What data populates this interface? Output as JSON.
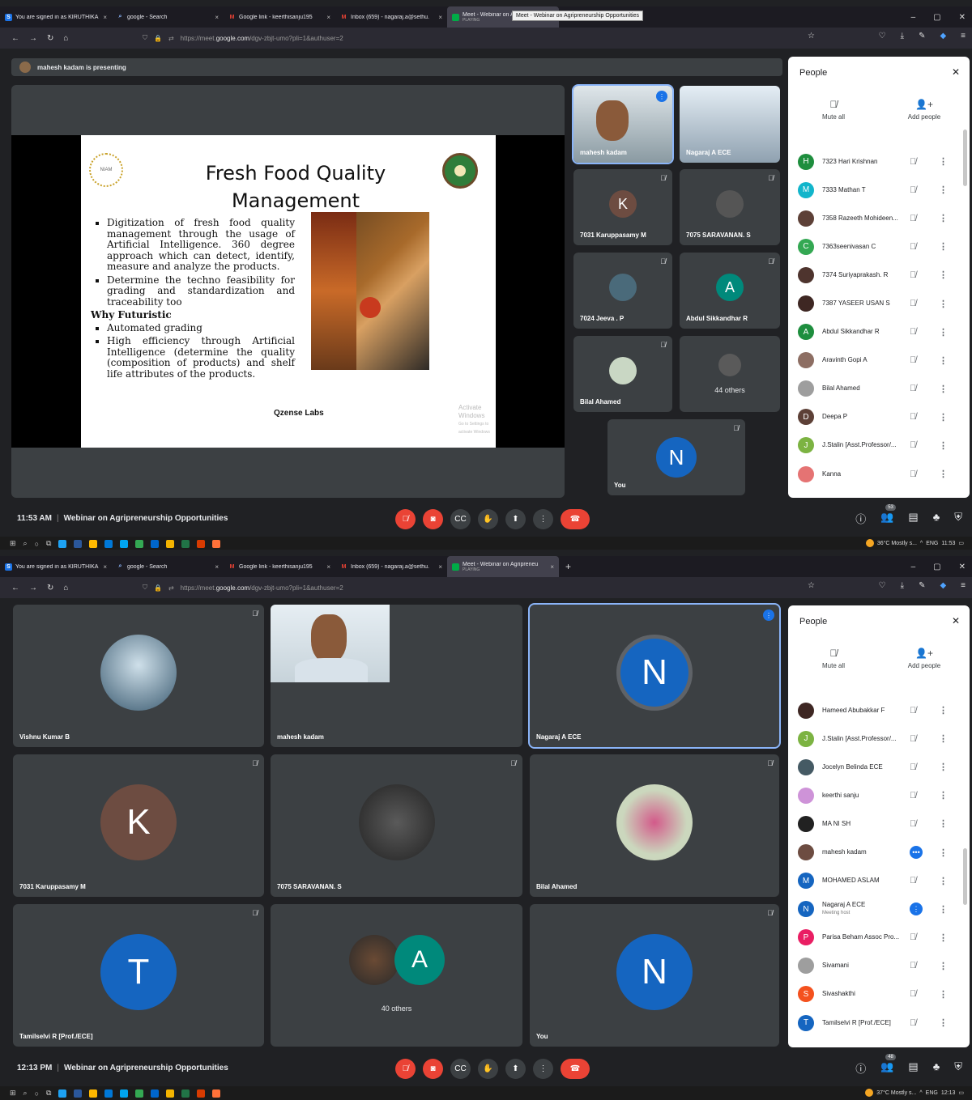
{
  "screenshots": [
    {
      "tabs": [
        {
          "label": "You are signed in as KIRUTHIKA",
          "icon": "s-icon",
          "color": "#1a73e8"
        },
        {
          "label": "google - Search",
          "icon": "search-icon",
          "color": "#5f6368"
        },
        {
          "label": "Google link - keerthisanju195",
          "icon": "gmail-icon",
          "color": "#ea4335"
        },
        {
          "label": "Inbox (659) - nagaraj.a@sethu.",
          "icon": "gmail-icon",
          "color": "#ea4335"
        },
        {
          "label": "Meet - Webinar on Agripreneu",
          "sub": "PLAYING",
          "icon": "meet-icon",
          "color": "#00ac47",
          "active": true
        }
      ],
      "tooltip": "Meet - Webinar on Agripreneurship Opportunities",
      "url_prefix": "https://meet.",
      "url_host": "google.com",
      "url_path": "/dgv-zbjt-umo?pli=1&authuser=2",
      "presenting": "mahesh kadam is presenting",
      "slide": {
        "title": "Fresh Food Quality Management",
        "logo_left": "NIAM",
        "bullets1": [
          "Digitization of fresh food quality management through the usage of Artificial Intelligence. 360 degree approach which can detect, identify, measure and analyze the products.",
          "Determine the techno feasibility for grading and standardization and traceability too"
        ],
        "heading": "Why Futuristic",
        "bullets2": [
          "Automated grading",
          "High efficiency through Artificial Intelligence (determine the quality (composition of products) and shelf life attributes of the products."
        ],
        "brand": "Qzense Labs",
        "watermark": "Activate Windows",
        "watermark_sub": "Go to Settings to activate Windows"
      },
      "tiles": [
        {
          "name": "mahesh kadam"
        },
        {
          "name": "Nagaraj A ECE"
        },
        {
          "name": "7031 Karuppasamy M",
          "initial": "K",
          "color": "#6d4c41"
        },
        {
          "name": "7075 SARAVANAN. S"
        },
        {
          "name": "7024 Jeeva . P"
        },
        {
          "name": "Abdul Sikkandhar R",
          "initial": "A",
          "color": "#00897b"
        },
        {
          "name": "Bilal Ahamed"
        },
        {
          "name": "44 others"
        },
        {
          "name": "You",
          "initial": "N",
          "color": "#1565c0"
        }
      ],
      "people": {
        "title": "People",
        "mute_all": "Mute all",
        "add_people": "Add people",
        "list": [
          {
            "name": "7323 Hari Krishnan",
            "initial": "H",
            "color": "#1e8e3e"
          },
          {
            "name": "7333 Mathan T",
            "initial": "M",
            "color": "#12b5cb"
          },
          {
            "name": "7358 Razeeth Mohideen...",
            "initial": "",
            "color": "#5d4037"
          },
          {
            "name": "7363seenivasan C",
            "initial": "C",
            "color": "#34a853"
          },
          {
            "name": "7374 Suriyaprakash. R",
            "initial": "",
            "color": "#4e342e"
          },
          {
            "name": "7387 YASEER USAN S",
            "initial": "",
            "color": "#3e2723"
          },
          {
            "name": "Abdul Sikkandhar R",
            "initial": "A",
            "color": "#1e8e3e"
          },
          {
            "name": "Aravinth Gopi A",
            "initial": "",
            "color": "#8d6e63"
          },
          {
            "name": "Bilal Ahamed",
            "initial": "",
            "color": "#9e9e9e"
          },
          {
            "name": "Deepa P",
            "initial": "D",
            "color": "#5d4037"
          },
          {
            "name": "J.Stalin [Asst.Professor/...",
            "initial": "J",
            "color": "#7cb342"
          },
          {
            "name": "Kanna",
            "initial": "",
            "color": "#e57373"
          }
        ]
      },
      "time": "11:53 AM",
      "meeting": "Webinar on Agripreneurship Opportunities",
      "participants_badge": "53",
      "tray": "36°C Mostly s...",
      "tray_lang": "ENG",
      "tray_time": "11:53"
    },
    {
      "tabs": [
        {
          "label": "You are signed in as KIRUTHIKA",
          "icon": "s-icon",
          "color": "#1a73e8"
        },
        {
          "label": "google - Search",
          "icon": "search-icon",
          "color": "#5f6368"
        },
        {
          "label": "Google link - keerthisanju195",
          "icon": "gmail-icon",
          "color": "#ea4335"
        },
        {
          "label": "Inbox (659) - nagaraj.a@sethu.",
          "icon": "gmail-icon",
          "color": "#ea4335"
        },
        {
          "label": "Meet - Webinar on Agripreneu",
          "sub": "PLAYING",
          "icon": "meet-icon",
          "color": "#00ac47",
          "active": true
        }
      ],
      "url_prefix": "https://meet.",
      "url_host": "google.com",
      "url_path": "/dgv-zbjt-umo?pli=1&authuser=2",
      "tiles": [
        {
          "name": "Vishnu Kumar B"
        },
        {
          "name": "mahesh kadam"
        },
        {
          "name": "Nagaraj A ECE",
          "initial": "N",
          "color": "#1565c0"
        },
        {
          "name": "7031 Karuppasamy M",
          "initial": "K",
          "color": "#6d4c41"
        },
        {
          "name": "7075 SARAVANAN. S"
        },
        {
          "name": "Bilal Ahamed"
        },
        {
          "name": "Tamilselvi R [Prof./ECE]",
          "initial": "T",
          "color": "#1565c0"
        },
        {
          "name": "40 others",
          "initial": "A",
          "color": "#00897b"
        },
        {
          "name": "You",
          "initial": "N",
          "color": "#1565c0"
        }
      ],
      "people": {
        "title": "People",
        "mute_all": "Mute all",
        "add_people": "Add people",
        "list": [
          {
            "name": "Hameed Abubakkar F",
            "initial": "",
            "color": "#3e2723"
          },
          {
            "name": "J.Stalin [Asst.Professor/...",
            "initial": "J",
            "color": "#7cb342"
          },
          {
            "name": "Jocelyn Belinda ECE",
            "initial": "",
            "color": "#455a64"
          },
          {
            "name": "keerthi sanju",
            "initial": "",
            "color": "#ce93d8"
          },
          {
            "name": "MA NI SH",
            "initial": "",
            "color": "#212121"
          },
          {
            "name": "mahesh kadam",
            "initial": "",
            "color": "#6d4c41",
            "speaking": true
          },
          {
            "name": "MOHAMED ASLAM",
            "initial": "M",
            "color": "#1565c0"
          },
          {
            "name": "Nagaraj A ECE",
            "sub": "Meeting host",
            "initial": "N",
            "color": "#1565c0",
            "speaking": true
          },
          {
            "name": "Parisa Beham Assoc Pro...",
            "initial": "P",
            "color": "#e91e63"
          },
          {
            "name": "Sivamani",
            "initial": "",
            "color": "#9e9e9e"
          },
          {
            "name": "Sivashakthi",
            "initial": "S",
            "color": "#f4511e"
          },
          {
            "name": "Tamilselvi R [Prof./ECE]",
            "initial": "T",
            "color": "#1565c0"
          }
        ]
      },
      "time": "12:13 PM",
      "meeting": "Webinar on Agripreneurship Opportunities",
      "participants_badge": "48",
      "tray": "37°C Mostly s...",
      "tray_lang": "ENG",
      "tray_time": "12:13"
    }
  ]
}
